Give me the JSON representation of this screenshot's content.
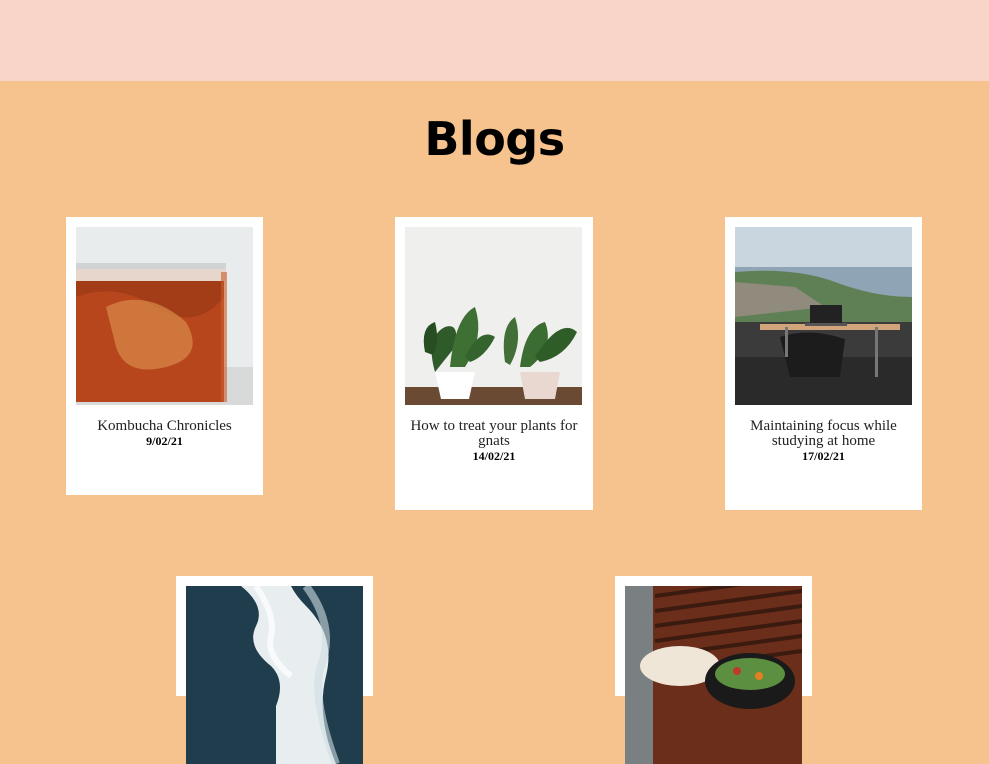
{
  "page": {
    "heading": "Blogs"
  },
  "posts": [
    {
      "title": "Kombucha Chronicles",
      "date": "9/02/21"
    },
    {
      "title": "How to treat your plants for gnats",
      "date": "14/02/21"
    },
    {
      "title": "Maintaining focus while studying at home",
      "date": "17/02/21"
    },
    {
      "title": "",
      "date": ""
    },
    {
      "title": "",
      "date": ""
    }
  ],
  "colors": {
    "header_bar": "#f8d5c8",
    "page_background": "#f6c28d",
    "card_background": "#ffffff"
  }
}
